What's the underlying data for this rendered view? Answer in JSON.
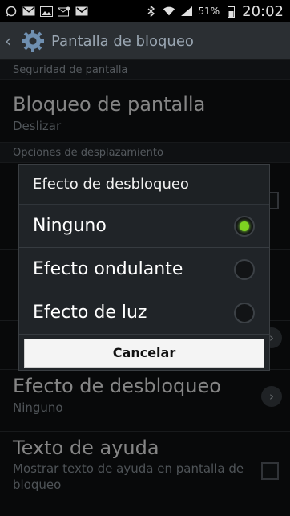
{
  "status_bar": {
    "battery_percent": "51%",
    "time": "20:02",
    "icons": [
      "whatsapp-icon",
      "mail-icon",
      "gallery-icon",
      "email-icon",
      "gmail-icon",
      "bluetooth-icon",
      "wifi-icon",
      "signal-icon",
      "battery-icon"
    ]
  },
  "action_bar": {
    "title": "Pantalla de bloqueo"
  },
  "sections": {
    "security": "Seguridad de pantalla",
    "scroll_options": "Opciones de desplazamiento"
  },
  "items": {
    "screen_lock": {
      "title": "Bloqueo de pantalla",
      "subtitle": "Deslizar"
    },
    "unlock_effect": {
      "title": "Efecto de desbloqueo",
      "subtitle": "Ninguno"
    },
    "help_text": {
      "title": "Texto de ayuda",
      "subtitle": "Mostrar texto de ayuda en pantalla de bloqueo"
    }
  },
  "dialog": {
    "title": "Efecto de desbloqueo",
    "options": [
      "Ninguno",
      "Efecto ondulante",
      "Efecto de luz"
    ],
    "selected_index": 0,
    "cancel_label": "Cancelar"
  },
  "colors": {
    "accent_green": "#7ed321",
    "action_bar": "#2b2f33"
  }
}
